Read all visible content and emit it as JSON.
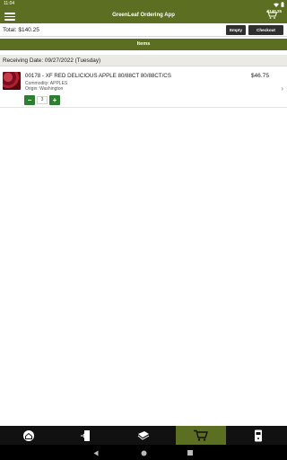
{
  "status_bar": {
    "time": "11:04"
  },
  "header": {
    "title": "GreenLeaf Ordering App",
    "cart_amount": "$140.25"
  },
  "totals": {
    "total_text": "Total:  $140.25",
    "empty_label": "Empty",
    "checkout_label": "Checkout"
  },
  "section": {
    "title": "Items"
  },
  "receiving": {
    "text": "Receiving Date: 09/27/2022 (Tuesday)"
  },
  "items": [
    {
      "title": "00178 - XF RED DELICIOUS APPLE 80/88CT 80/88CT/CS",
      "price": "$46.75",
      "commodity": "Commodity: APPLES",
      "origin": "Origin: Washington",
      "quantity": "3",
      "minus": "−",
      "plus": "+"
    }
  ],
  "bottom_nav": {
    "items": [
      {
        "icon": "home-icon"
      },
      {
        "icon": "door-icon"
      },
      {
        "icon": "catalog-icon"
      },
      {
        "icon": "cart-icon",
        "active": true
      },
      {
        "icon": "phone-icon"
      }
    ]
  },
  "colors": {
    "brand_green": "#5c6e22",
    "button_green": "#2e7d32",
    "dark_button": "#2f2f2f"
  }
}
